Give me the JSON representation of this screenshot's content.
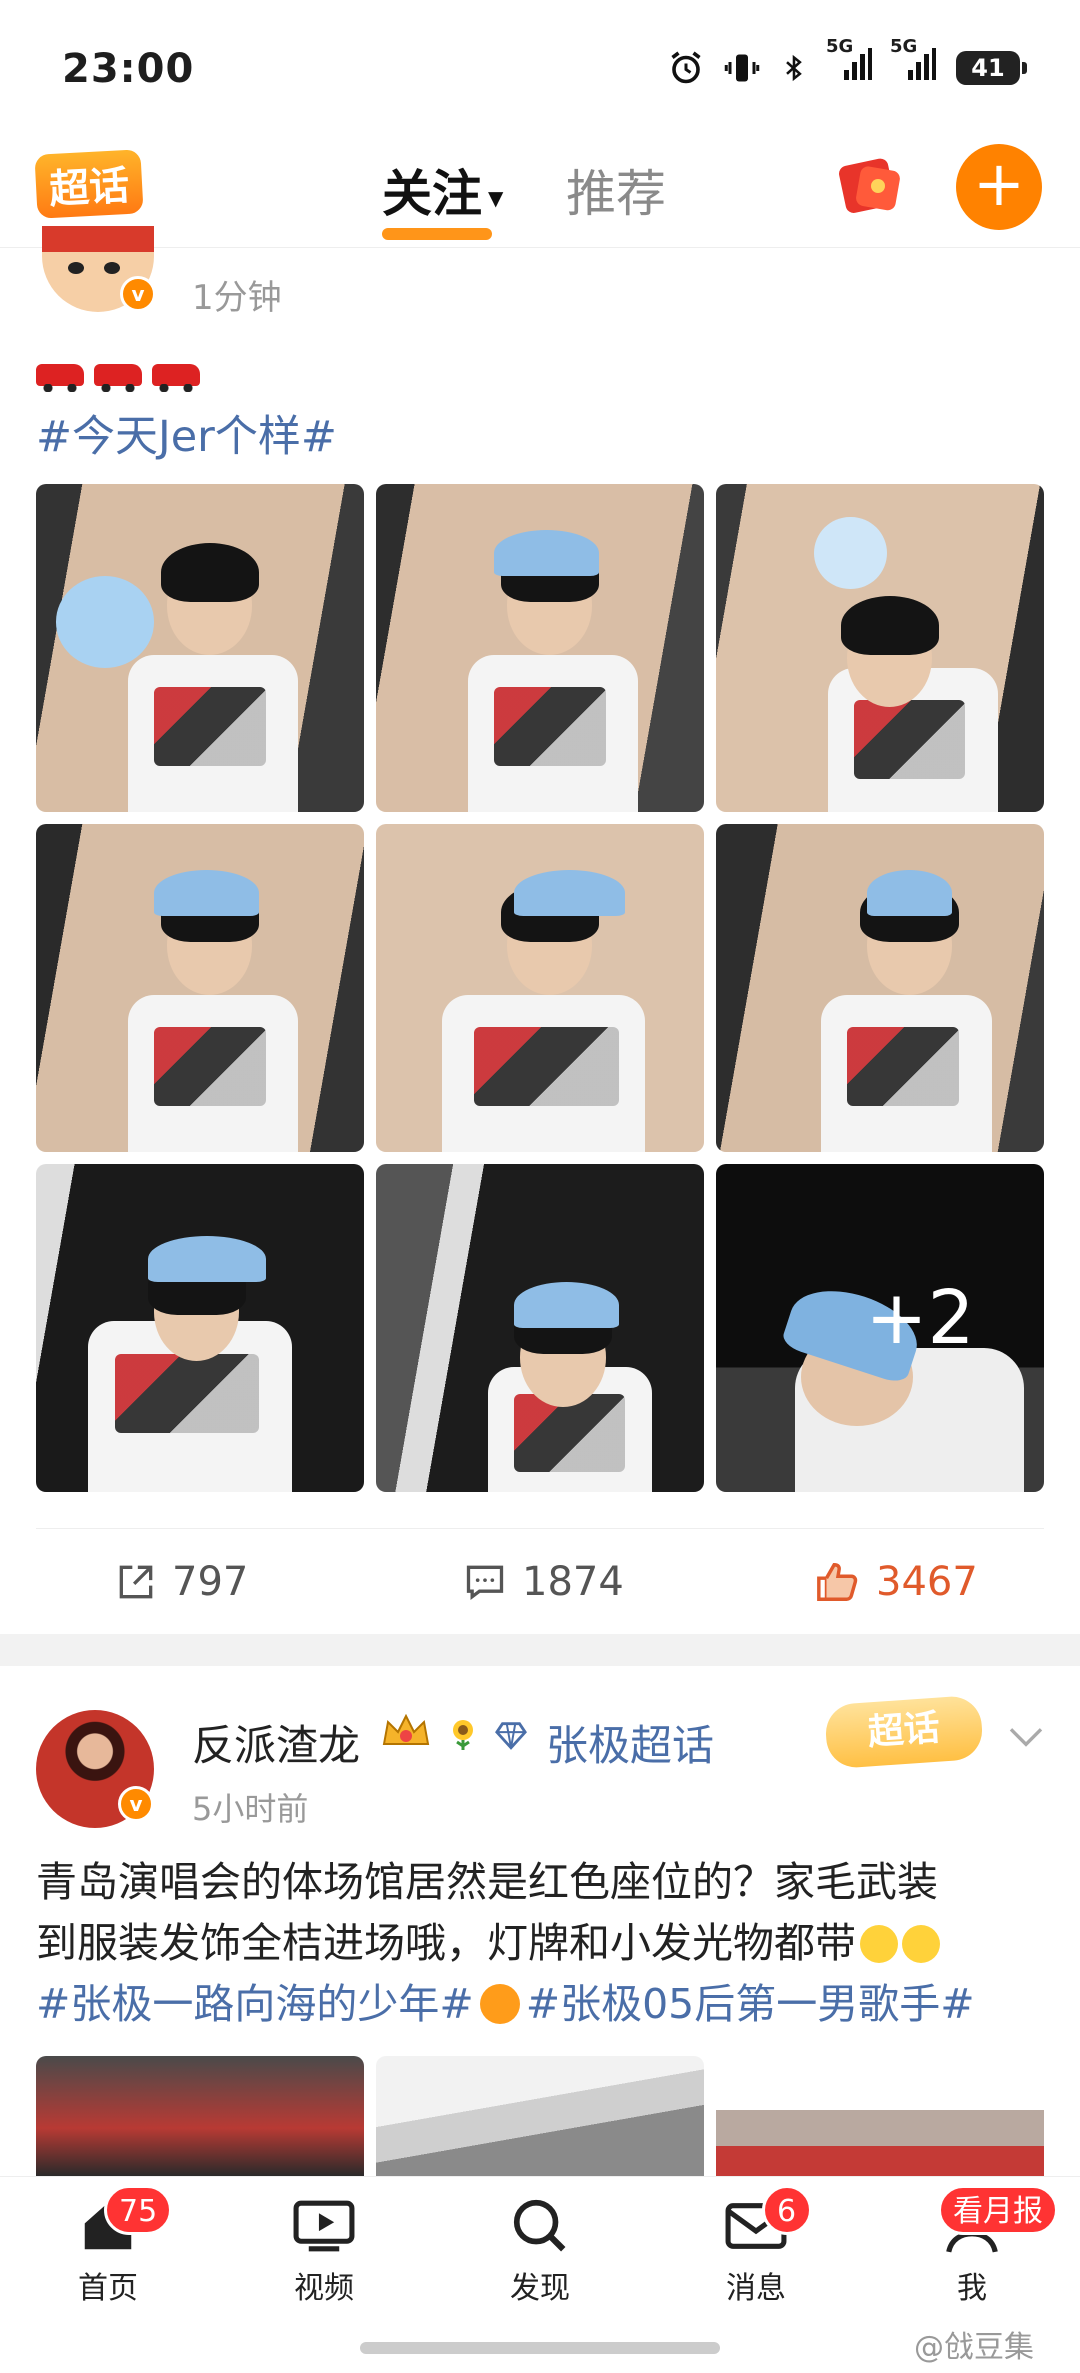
{
  "status_bar": {
    "time": "23:00",
    "signal_1": "5G",
    "signal_2": "5G",
    "battery": "41"
  },
  "header": {
    "logo": "超话",
    "tab_follow": "关注",
    "tab_recommend": "推荐"
  },
  "post1": {
    "time": "1分钟",
    "hashtag": "#今天Jer个样#",
    "more_count": "+2",
    "shares": "797",
    "comments": "1874",
    "likes": "3467"
  },
  "post2": {
    "username": "反派渣龙",
    "super_topic": "张极超话",
    "chaohua_badge": "超话",
    "time": "5小时前",
    "text_line1": "青岛演唱会的体场馆居然是红色座位的？家毛武装",
    "text_line2": "到服装发饰全桔进场哦，灯牌和小发光物都带",
    "hashtag1": "#张极一路向海的少年#",
    "hashtag2": "#张极05后第一男歌手#"
  },
  "tabbar": {
    "home": "首页",
    "home_badge": "75",
    "video": "视频",
    "discover": "发现",
    "messages": "消息",
    "messages_badge": "6",
    "me": "我",
    "me_badge": "看月报"
  },
  "watermark": "@戗豆集",
  "colors": {
    "accent": "#ff8200",
    "link": "#4a6ea8",
    "like": "#e05a2b"
  }
}
